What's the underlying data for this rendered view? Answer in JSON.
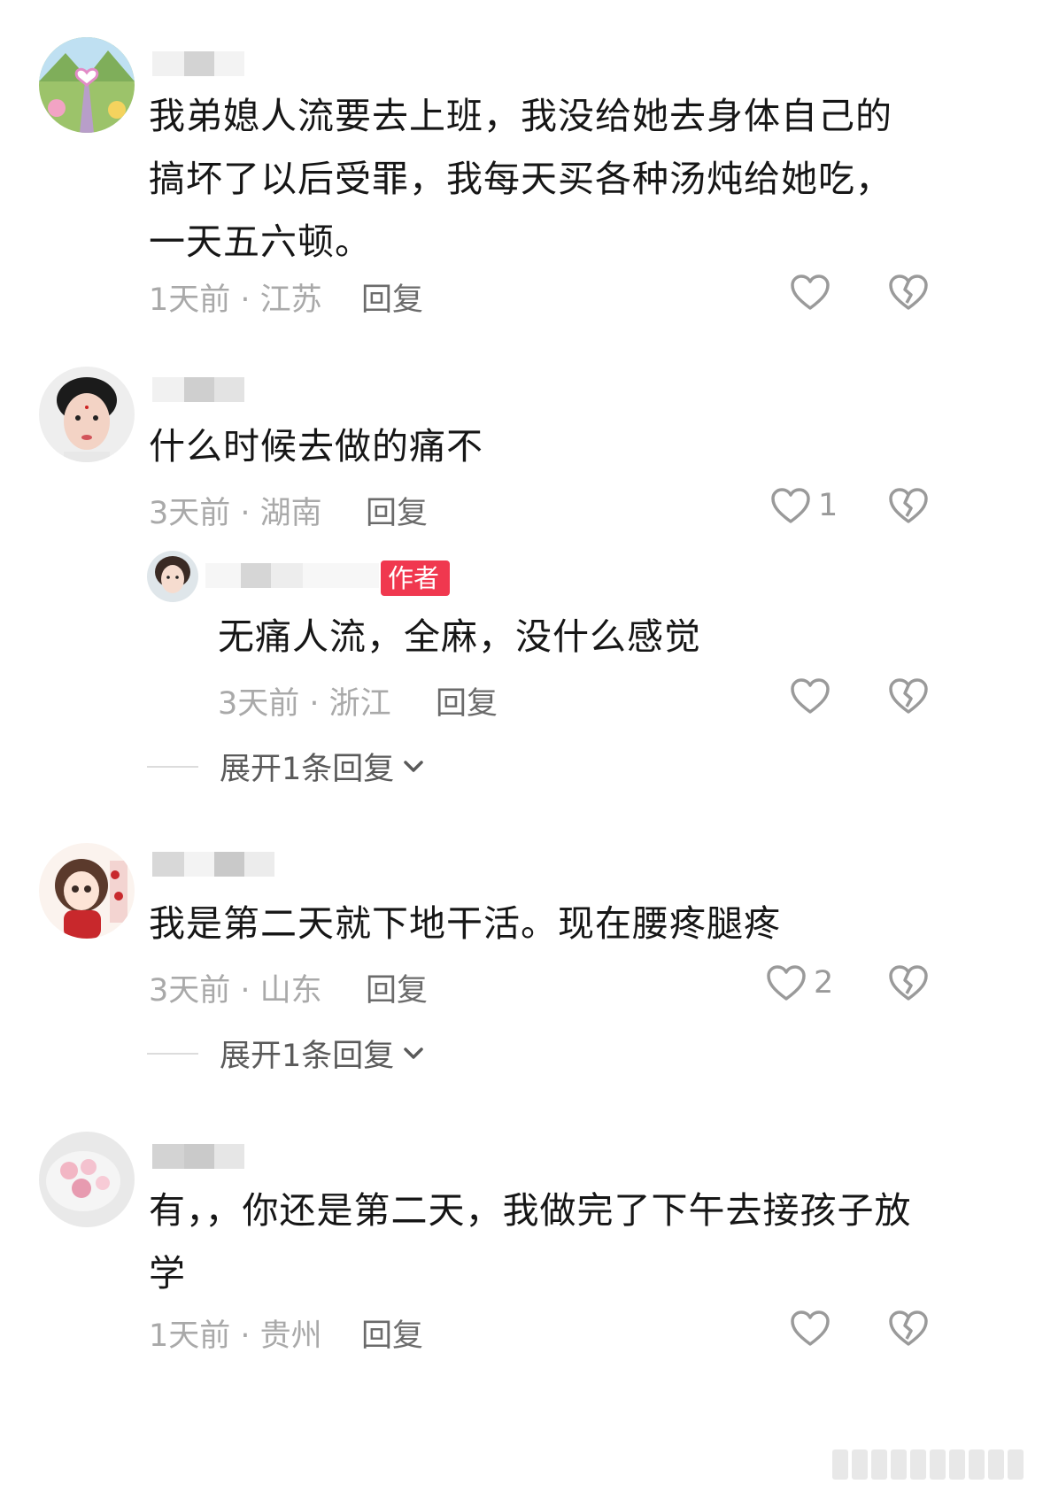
{
  "comments": [
    {
      "text": "我弟媳人流要去上班，我没给她去身体自己的搞坏了以后受罪，我每天买各种汤炖给她吃，一天五六顿。",
      "time_location": "1天前 · 江苏",
      "reply_label": "回复",
      "likes": ""
    },
    {
      "text": "什么时候去做的痛不",
      "time_location": "3天前 · 湖南",
      "reply_label": "回复",
      "likes": "1",
      "sub_reply": {
        "author_badge": "作者",
        "text": "无痛人流，全麻，没什么感觉",
        "time_location": "3天前 · 浙江",
        "reply_label": "回复"
      },
      "expand_label": "展开1条回复"
    },
    {
      "text": "我是第二天就下地干活。现在腰疼腿疼",
      "time_location": "3天前 · 山东",
      "reply_label": "回复",
      "likes": "2",
      "expand_label": "展开1条回复"
    },
    {
      "text": "有，，你还是第二天，我做完了下午去接孩子放学",
      "time_location": "1天前 · 贵州",
      "reply_label": "回复",
      "likes": ""
    }
  ],
  "icons": {
    "like": "heart-outline-icon",
    "dislike": "broken-heart-icon",
    "expand": "chevron-down-icon"
  },
  "colors": {
    "author_badge": "#f0384f",
    "meta_text": "#a9a9a9"
  }
}
